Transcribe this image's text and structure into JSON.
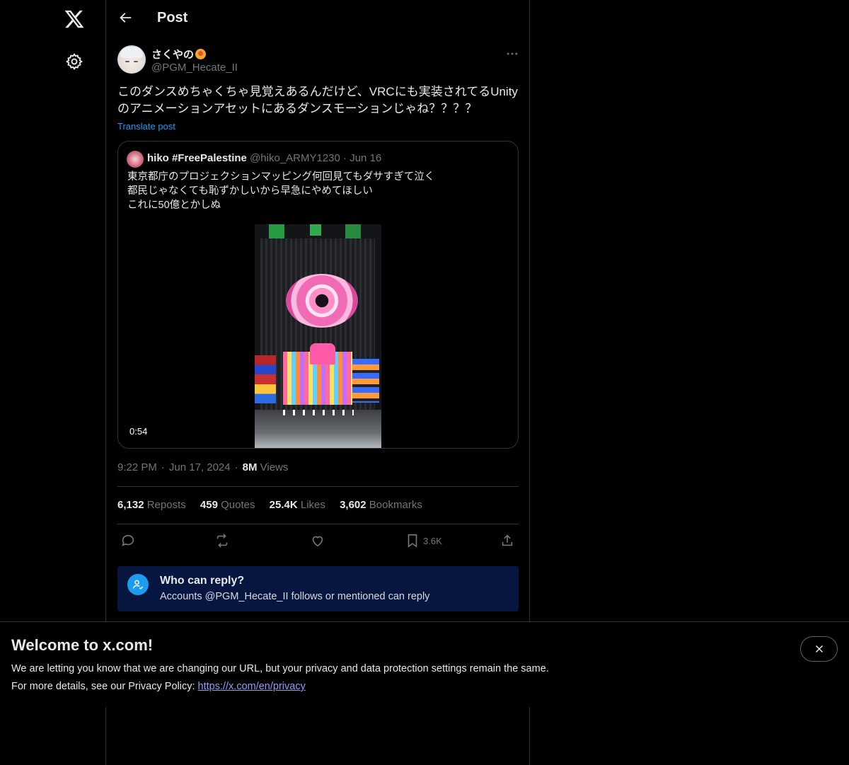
{
  "header": {
    "title": "Post"
  },
  "post": {
    "author_name": "さくやの",
    "author_handle": "@PGM_Hecate_II",
    "text": "このダンスめちゃくちゃ見覚えあるんだけど、VRCにも実装されてるUnityのアニメーションアセットにあるダンスモーションじゃね？？？？",
    "translate_label": "Translate post",
    "time": "9:22 PM",
    "date": "Jun 17, 2024",
    "views_count": "8M",
    "views_label": "Views"
  },
  "quote": {
    "name": "hiko #FreePalestine",
    "handle": "@hiko_ARMY1230",
    "dot": "·",
    "date": "Jun 16",
    "lines": [
      "東京都庁のプロジェクションマッピング何回見てもダサすぎて泣く",
      "都民じゃなくても恥ずかしいから早急にやめてほしい",
      "これに50億とかしぬ"
    ],
    "duration": "0:54"
  },
  "stats": {
    "reposts": {
      "count": "6,132",
      "label": "Reposts"
    },
    "quotes": {
      "count": "459",
      "label": "Quotes"
    },
    "likes": {
      "count": "25.4K",
      "label": "Likes"
    },
    "bookmarks": {
      "count": "3,602",
      "label": "Bookmarks"
    }
  },
  "actions": {
    "bookmark_count": "3.6K"
  },
  "reply_restriction": {
    "title": "Who can reply?",
    "description": "Accounts @PGM_Hecate_II follows or mentioned can reply"
  },
  "banner": {
    "title": "Welcome to x.com!",
    "line1": "We are letting you know that we are changing our URL, but your privacy and data protection settings remain the same.",
    "line2_prefix": "For more details, see our Privacy Policy: ",
    "link": "https://x.com/en/privacy"
  },
  "colors": {
    "accent": "#1d9bf0",
    "muted": "#71767b",
    "border": "#2f3336",
    "reply_box_bg": "#061640"
  },
  "icons": [
    "x-logo-icon",
    "settings-icon",
    "back-arrow-icon",
    "more-icon",
    "reply-icon",
    "repost-icon",
    "like-icon",
    "bookmark-icon",
    "share-icon",
    "user-check-icon",
    "close-icon"
  ]
}
